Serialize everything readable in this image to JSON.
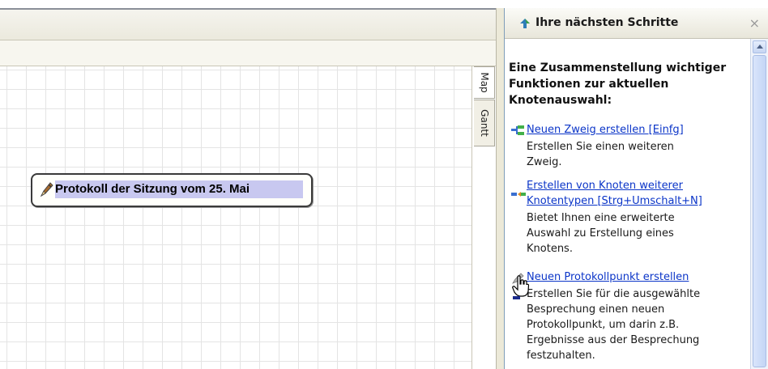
{
  "mindmap": {
    "node_text": "Protokoll der Sitzung vom 25. Mai"
  },
  "view_tabs": [
    {
      "label": "Map"
    },
    {
      "label": "Gantt"
    }
  ],
  "panel": {
    "title": "Ihre nächsten Schritte",
    "close_glyph": "×",
    "heading": "Eine Zusammenstellung wichtiger Funktionen zur aktuellen Knotenauswahl:",
    "items": [
      {
        "icon": "branch-icon",
        "link_lines": [
          "Neuen Zweig erstellen [Einfg]"
        ],
        "desc_lines": [
          "Erstellen Sie einen weiteren",
          "Zweig."
        ]
      },
      {
        "icon": "node-types-icon",
        "link_lines": [
          "Erstellen von Knoten weiterer",
          "Knotentypen [Strg+Umschalt+N]"
        ],
        "desc_lines": [
          "Bietet Ihnen eine erweiterte",
          "Auswahl zu Erstellung eines",
          "Knotens."
        ]
      },
      {
        "icon": "protocol-point-icon",
        "link_lines": [
          "Neuen Protokollpunkt erstellen"
        ],
        "desc_lines": [
          "Erstellen Sie für die ausgewählte",
          "Besprechung einen neuen",
          "Protokollpunkt, um darin z.B.",
          "Ergebnisse aus der Besprechung",
          "festzuhalten."
        ]
      }
    ]
  },
  "colors": {
    "link": "#0b35c8",
    "node_highlight": "#c8c8f0",
    "grid": "#e4e4e4"
  }
}
